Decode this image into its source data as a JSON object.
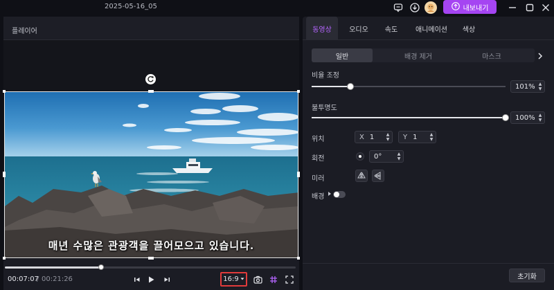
{
  "window": {
    "project_title": "2025-05-16_05",
    "export_label": "내보내기",
    "icons": [
      "message-icon",
      "download-icon",
      "avatar",
      "export-icon",
      "minimize-icon",
      "maximize-icon",
      "close-icon"
    ]
  },
  "player": {
    "title": "플레이어",
    "subtitle": "매년 수많은 관광객을 끌어모으고 있습니다.",
    "time_current": "00:07:07",
    "time_separator": "/",
    "time_total": "00:21:26",
    "progress_fraction": 0.33,
    "aspect_ratio": "16:9",
    "colors": {
      "ratio_highlight": "#e23b3b"
    }
  },
  "panel": {
    "tabs": [
      "동영상",
      "오디오",
      "속도",
      "애니메이션",
      "색상"
    ],
    "active_tab": "동영상",
    "sub_tabs": [
      "일반",
      "배경 제거",
      "마스크"
    ],
    "active_sub_tab": "일반",
    "scale": {
      "label": "비율 조정",
      "value": "101",
      "unit": "%",
      "fraction": 0.2
    },
    "opacity": {
      "label": "불투명도",
      "value": "100",
      "unit": "%",
      "fraction": 1.0
    },
    "position": {
      "label": "위치",
      "x_label": "X",
      "x_value": "1",
      "y_label": "Y",
      "y_value": "1"
    },
    "rotation": {
      "label": "회전",
      "value": "0°"
    },
    "mirror": {
      "label": "미러"
    },
    "background": {
      "label": "배경"
    },
    "reset_label": "초기화",
    "colors": {
      "accent": "#b565ff",
      "export_button": "#a545f2"
    }
  }
}
